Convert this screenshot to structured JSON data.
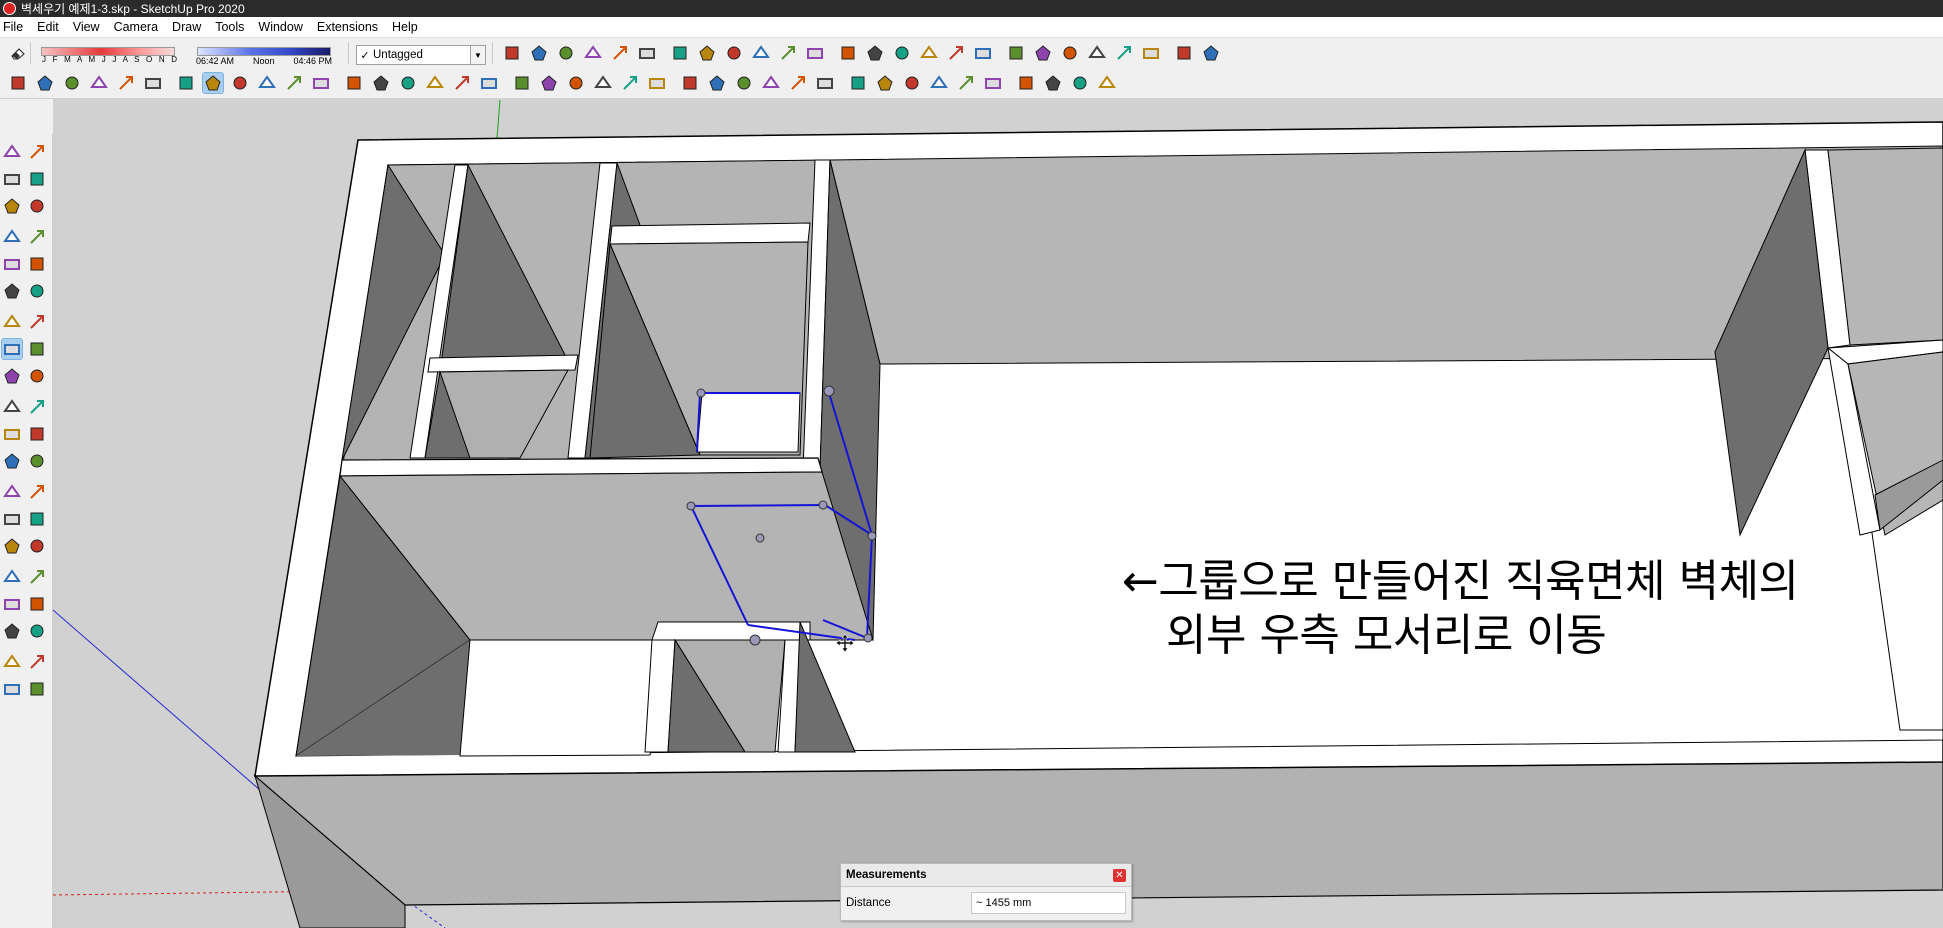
{
  "window": {
    "title": "벽세우기 예제1-3.skp - SketchUp Pro 2020"
  },
  "menu": [
    "File",
    "Edit",
    "View",
    "Camera",
    "Draw",
    "Tools",
    "Window",
    "Extensions",
    "Help"
  ],
  "shadow_settings": {
    "months": "J F M A M J J A S O N D",
    "time_early": "06:42 AM",
    "time_noon": "Noon",
    "time_late": "04:46 PM"
  },
  "tag_selector": {
    "value": "Untagged",
    "checked": true
  },
  "toolbar_icons": {
    "row1": [
      "eraser-icon",
      "section-plane-icon",
      "display-section-planes-icon",
      "display-section-cuts-icon",
      "xray-icon",
      "back-edges-icon",
      "wireframe-icon",
      "hidden-line-icon",
      "shaded-icon",
      "shaded-textures-icon",
      "monochrome-icon",
      "iso-view-icon",
      "top-view-icon",
      "front-view-icon",
      "right-view-icon",
      "back-view-icon",
      "left-view-icon",
      "orbit-icon",
      "pan-icon",
      "zoom-icon",
      "zoom-window-icon",
      "zoom-extents-icon",
      "position-camera-icon",
      "look-around-icon",
      "walk-icon",
      "warehouse-icon"
    ],
    "row2": [
      "select-icon",
      "eraser-icon",
      "pencil-icon",
      "arc-icon",
      "rectangle-icon",
      "push-pull-icon",
      "follow-me-icon",
      "move-icon",
      "rotate-icon",
      "scale-icon",
      "tape-measure-icon",
      "text-icon",
      "paint-bucket-icon",
      "orbit-icon",
      "pan-icon",
      "zoom-icon",
      "zoom-extents-icon",
      "sandbox-icon",
      "extension-warehouse-icon",
      "ruby-icon",
      "profile-icon",
      "component-icon",
      "make-group-icon",
      "house-icon",
      "door-icon",
      "window-icon",
      "solid-tools-icon",
      "union-icon",
      "subtract-icon",
      "trim-icon",
      "intersect-icon",
      "split-icon",
      "layout-icon",
      "dynamic-component-icon",
      "styles-icon",
      "shadows-icon",
      "axes-icon",
      "guide-icon",
      "fog-icon",
      "camera-icon"
    ]
  },
  "left_tools": [
    "select-icon",
    "make-component-icon",
    "paint-bucket-icon",
    "eraser-icon",
    "line-icon",
    "freehand-icon",
    "rectangle-icon",
    "rotated-rectangle-icon",
    "circle-icon",
    "polygon-icon",
    "arc-icon",
    "two-point-arc-icon",
    "three-point-arc-icon",
    "pie-icon",
    "move-icon",
    "push-pull-icon",
    "rotate-icon",
    "follow-me-icon",
    "scale-icon",
    "offset-icon",
    "tape-measure-icon",
    "dimension-icon",
    "protractor-icon",
    "text-icon",
    "axes-icon",
    "3d-text-icon",
    "orbit-icon",
    "pan-icon",
    "zoom-icon",
    "zoom-window-icon",
    "zoom-extents-icon",
    "previous-view-icon",
    "position-camera-icon",
    "look-around-icon",
    "walk-icon",
    "section-plane-icon",
    "warehouse-icon",
    "extension-warehouse-icon",
    "layout-icon",
    "ruby-icon"
  ],
  "active_tool": "move-icon",
  "annotation": {
    "line1": "←그룹으로 만들어진 직육면체 벽체의",
    "line2": "외부 우측 모서리로 이동"
  },
  "measurements": {
    "title": "Measurements",
    "label": "Distance",
    "value": "~ 1455 mm"
  },
  "colors": {
    "wall_top": "#ffffff",
    "wall_face_light": "#b8b8b8",
    "wall_face_dark": "#6e6e6e",
    "floor": "#ffffff",
    "selection": "#0000e0",
    "background": "#d1d1d1"
  }
}
